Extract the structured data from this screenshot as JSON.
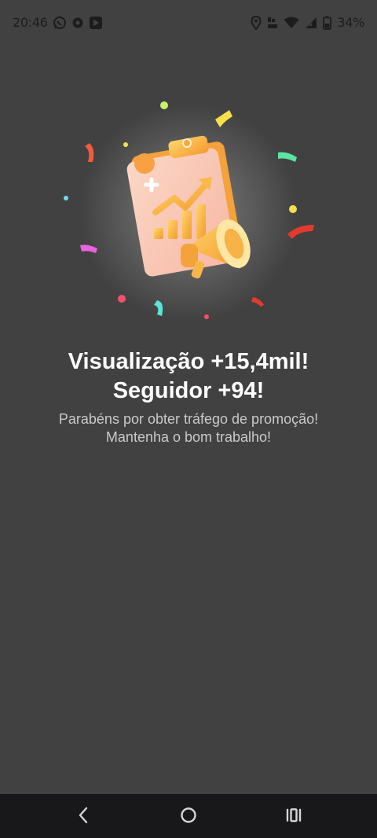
{
  "status_bar": {
    "time": "20:46",
    "battery": "34%",
    "left_icons": [
      "whatsapp-icon",
      "vpn-icon",
      "play-store-icon"
    ],
    "right_icons": [
      "location-icon",
      "volte-icon",
      "wifi-icon",
      "signal-icon",
      "battery-icon"
    ]
  },
  "illustration": {
    "name": "promotion-clipboard-megaphone",
    "accent_colors": [
      "#f7b24a",
      "#f9c9b8",
      "#f08c3a",
      "#fff4d6"
    ]
  },
  "congrats": {
    "title_line1": "Visualização +15,4mil!",
    "title_line2": "Seguidor +94!",
    "subtitle_line1": "Parabéns por obter tráfego de promoção!",
    "subtitle_line2": "Mantenha o bom trabalho!"
  },
  "nav_bar": {
    "buttons": [
      "back-icon",
      "home-icon",
      "recent-apps-icon"
    ]
  },
  "colors": {
    "background": "#424141",
    "navbar": "#18181b",
    "title": "#ffffff",
    "subtitle": "#c9c9c9"
  }
}
